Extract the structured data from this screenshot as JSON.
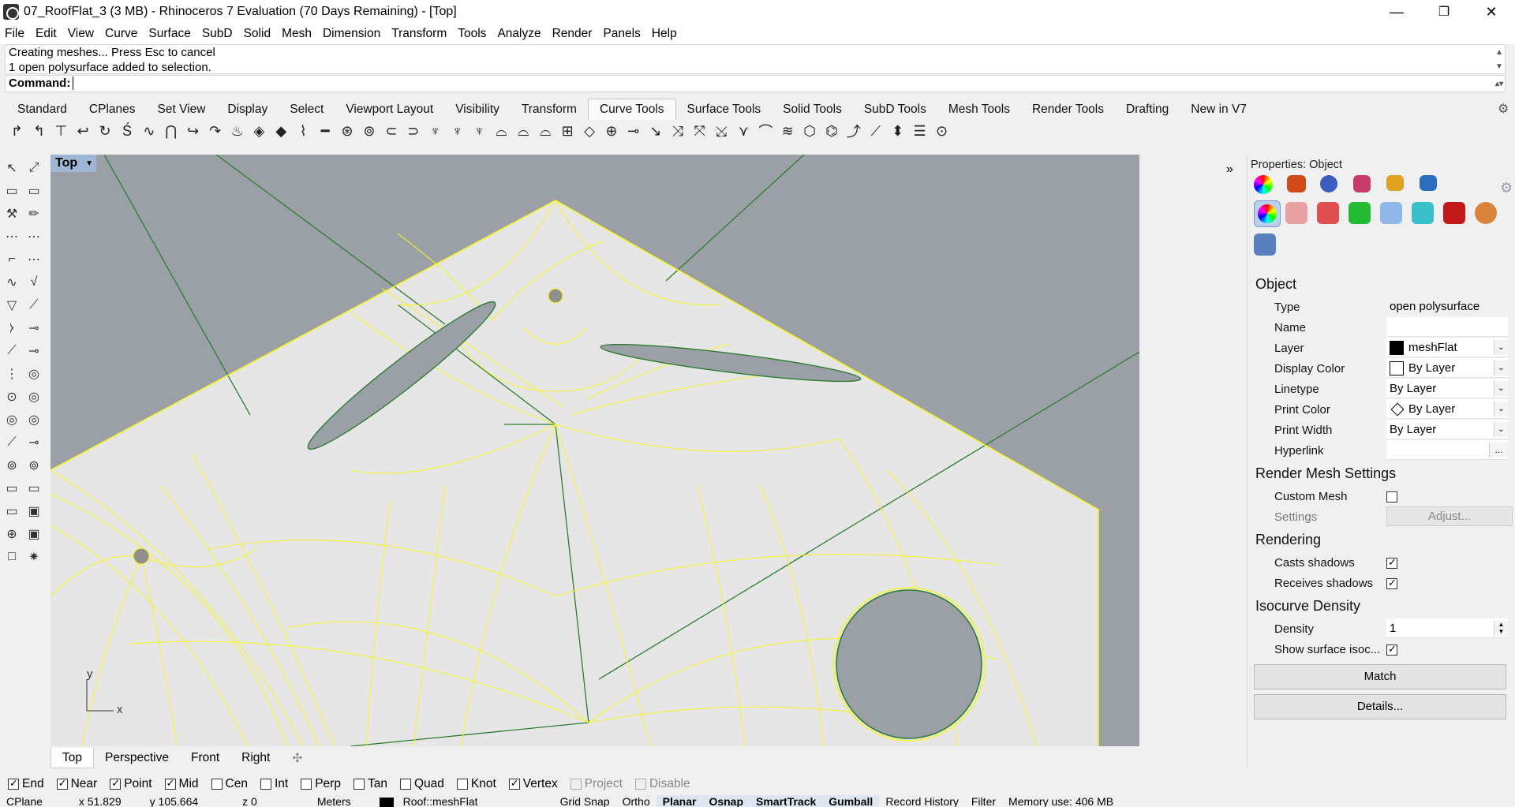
{
  "window": {
    "title": "07_RoofFlat_3 (3 MB) - Rhinoceros 7 Evaluation (70 Days Remaining) - [Top]",
    "minimize": "—",
    "maximize": "❐",
    "close": "✕"
  },
  "menu": [
    "File",
    "Edit",
    "View",
    "Curve",
    "Surface",
    "SubD",
    "Solid",
    "Mesh",
    "Dimension",
    "Transform",
    "Tools",
    "Analyze",
    "Render",
    "Panels",
    "Help"
  ],
  "command": {
    "history": [
      "Creating meshes... Press Esc to cancel",
      "1 open polysurface added to selection."
    ],
    "prompt": "Command:"
  },
  "toolbar_tabs": {
    "items": [
      "Standard",
      "CPlanes",
      "Set View",
      "Display",
      "Select",
      "Viewport Layout",
      "Visibility",
      "Transform",
      "Curve Tools",
      "Surface Tools",
      "Solid Tools",
      "SubD Tools",
      "Mesh Tools",
      "Render Tools",
      "Drafting",
      "New in V7"
    ],
    "active": "Curve Tools",
    "gear": "⚙"
  },
  "toolbar_icons": [
    "↱",
    "↰",
    "⊤",
    "↩",
    "↻",
    "Ś",
    "∿",
    "⋂",
    "↪",
    "↷",
    "♨",
    "◈",
    "◆",
    "⌇",
    "━",
    "⊛",
    "⊚",
    "⊂",
    "⊃",
    "♆",
    "♆",
    "♆",
    "⌓",
    "⌓",
    "⌓",
    "⊞",
    "◇",
    "⊕",
    "⊸",
    "↘",
    "⤨",
    "⤧",
    "⤩",
    "⋎",
    "⌒",
    "≋",
    "⬡",
    "⌬",
    "⤴",
    "⟋",
    "⬍",
    "☰",
    "⊙"
  ],
  "left_tools": [
    "↖",
    "⤢",
    "▭",
    "▭",
    "⚒",
    "✏",
    "⋯",
    "⋯",
    "⌐",
    "⋯",
    "∿",
    "√",
    "▽",
    "⟋",
    "⧽",
    "⊸",
    "⟋",
    "⊸",
    "⋮",
    "◎",
    "⊙",
    "◎",
    "◎",
    "◎",
    "⟋",
    "⊸",
    "⊚",
    "⊚",
    "▭",
    "▭",
    "▭",
    "▣",
    "⊕",
    "▣",
    "□",
    "✷"
  ],
  "viewport": {
    "name": "Top",
    "dropdown": "▼",
    "collapse": "»",
    "axis_x": "x",
    "axis_y": "y"
  },
  "view_tabs": {
    "items": [
      "Top",
      "Perspective",
      "Front",
      "Right"
    ],
    "active": "Top",
    "add": "✣"
  },
  "osnap": [
    {
      "label": "End",
      "on": true,
      "disabled": false
    },
    {
      "label": "Near",
      "on": true,
      "disabled": false
    },
    {
      "label": "Point",
      "on": true,
      "disabled": false
    },
    {
      "label": "Mid",
      "on": true,
      "disabled": false
    },
    {
      "label": "Cen",
      "on": false,
      "disabled": false
    },
    {
      "label": "Int",
      "on": false,
      "disabled": false
    },
    {
      "label": "Perp",
      "on": false,
      "disabled": false
    },
    {
      "label": "Tan",
      "on": false,
      "disabled": false
    },
    {
      "label": "Quad",
      "on": false,
      "disabled": false
    },
    {
      "label": "Knot",
      "on": false,
      "disabled": false
    },
    {
      "label": "Vertex",
      "on": true,
      "disabled": false
    },
    {
      "label": "Project",
      "on": false,
      "disabled": true
    },
    {
      "label": "Disable",
      "on": false,
      "disabled": true
    }
  ],
  "status": {
    "cplane": "CPlane",
    "x": "x 51.829",
    "y": "y 105.664",
    "z": "z 0",
    "units": "Meters",
    "layer": "Roof::meshFlat",
    "grid_snap": "Grid Snap",
    "ortho": "Ortho",
    "planar": "Planar",
    "osnap": "Osnap",
    "smarttrack": "SmartTrack",
    "gumball": "Gumball",
    "record_history": "Record History",
    "filter": "Filter",
    "memory": "Memory use: 406 MB"
  },
  "properties": {
    "title": "Properties: Object",
    "object": {
      "heading": "Object",
      "type_label": "Type",
      "type_value": "open polysurface",
      "name_label": "Name",
      "name_value": "",
      "layer_label": "Layer",
      "layer_value": "meshFlat",
      "display_color_label": "Display Color",
      "display_color_value": "By Layer",
      "linetype_label": "Linetype",
      "linetype_value": "By Layer",
      "print_color_label": "Print Color",
      "print_color_value": "By Layer",
      "print_width_label": "Print Width",
      "print_width_value": "By Layer",
      "hyperlink_label": "Hyperlink",
      "hyperlink_btn": "..."
    },
    "render_mesh": {
      "heading": "Render Mesh Settings",
      "custom_label": "Custom Mesh",
      "settings_label": "Settings",
      "adjust_btn": "Adjust..."
    },
    "rendering": {
      "heading": "Rendering",
      "casts_label": "Casts shadows",
      "receives_label": "Receives shadows"
    },
    "isocurve": {
      "heading": "Isocurve Density",
      "density_label": "Density",
      "density_value": "1",
      "show_label": "Show surface isoc..."
    },
    "match_btn": "Match",
    "details_btn": "Details...",
    "panel_gear": "⚙"
  }
}
